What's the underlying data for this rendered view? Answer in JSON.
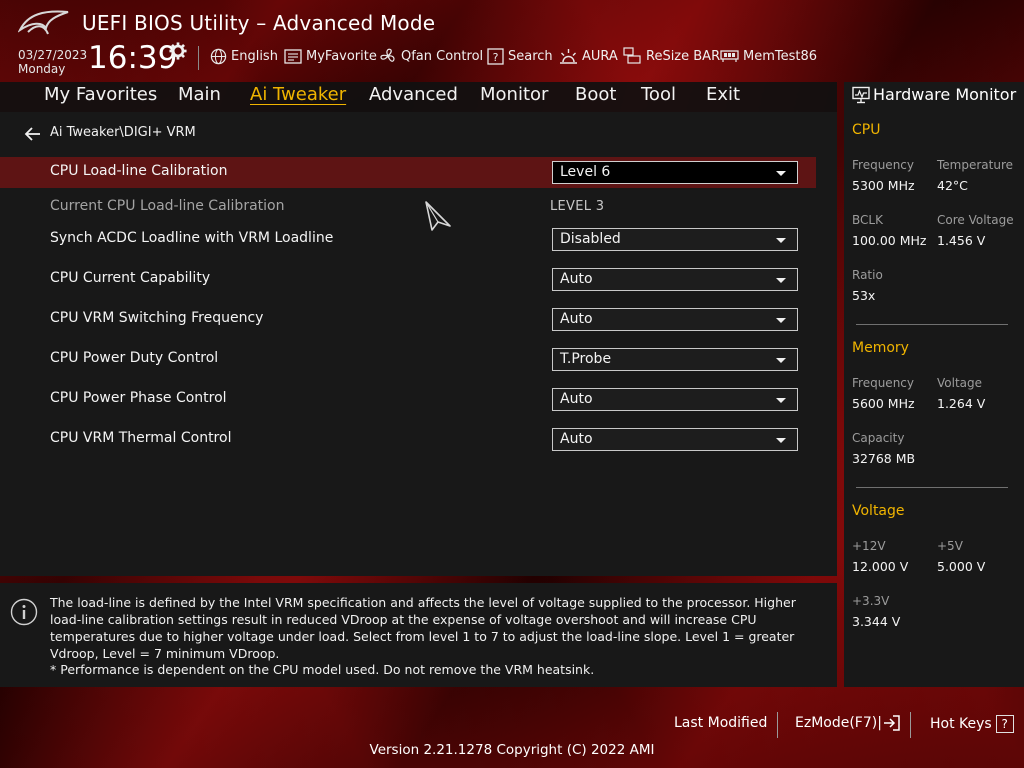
{
  "header": {
    "title": "UEFI BIOS Utility – Advanced Mode",
    "date": "03/27/2023",
    "weekday": "Monday",
    "time": "16:39",
    "tools": [
      {
        "label": "English",
        "icon": "globe-icon"
      },
      {
        "label": "MyFavorite",
        "icon": "favorite-icon"
      },
      {
        "label": "Qfan Control",
        "icon": "fan-icon"
      },
      {
        "label": "Search",
        "icon": "search-icon"
      },
      {
        "label": "AURA",
        "icon": "aura-icon"
      },
      {
        "label": "ReSize BAR",
        "icon": "resize-bar-icon"
      },
      {
        "label": "MemTest86",
        "icon": "memtest-icon"
      }
    ]
  },
  "menu": {
    "tabs": [
      "My Favorites",
      "Main",
      "Ai Tweaker",
      "Advanced",
      "Monitor",
      "Boot",
      "Tool",
      "Exit"
    ],
    "active": "Ai Tweaker"
  },
  "main": {
    "breadcrumb": "Ai Tweaker\\DIGI+ VRM",
    "items": [
      {
        "label": "CPU Load-line Calibration",
        "value": "Level 6"
      },
      {
        "label": "Current CPU Load-line Calibration",
        "value": "LEVEL 3"
      },
      {
        "label": "Synch ACDC Loadline with VRM Loadline",
        "value": "Disabled"
      },
      {
        "label": "CPU Current Capability",
        "value": "Auto"
      },
      {
        "label": "CPU VRM Switching Frequency",
        "value": "Auto"
      },
      {
        "label": "CPU Power Duty Control",
        "value": "T.Probe"
      },
      {
        "label": "CPU Power Phase Control",
        "value": "Auto"
      },
      {
        "label": "CPU VRM Thermal Control",
        "value": "Auto"
      }
    ]
  },
  "help": {
    "text": "The load-line is defined by the Intel VRM specification and affects the level of voltage supplied to the processor. Higher load-line calibration settings result in reduced VDroop at the expense of voltage overshoot and will increase CPU temperatures due to higher voltage under load. Select from level 1 to 7 to adjust the load-line slope. Level 1 = greater Vdroop, Level = 7 minimum VDroop.",
    "note": "* Performance is dependent on the CPU model used. Do not remove the VRM heatsink."
  },
  "hw": {
    "title": "Hardware Monitor",
    "cpu": {
      "heading": "CPU",
      "frequency_label": "Frequency",
      "frequency": "5300 MHz",
      "temperature_label": "Temperature",
      "temperature": "42°C",
      "bclk_label": "BCLK",
      "bclk": "100.00 MHz",
      "core_voltage_label": "Core Voltage",
      "core_voltage": "1.456 V",
      "ratio_label": "Ratio",
      "ratio": "53x"
    },
    "memory": {
      "heading": "Memory",
      "frequency_label": "Frequency",
      "frequency": "5600 MHz",
      "voltage_label": "Voltage",
      "voltage": "1.264 V",
      "capacity_label": "Capacity",
      "capacity": "32768 MB"
    },
    "voltage": {
      "heading": "Voltage",
      "v12_label": "+12V",
      "v12": "12.000 V",
      "v5_label": "+5V",
      "v5": "5.000 V",
      "v33_label": "+3.3V",
      "v33": "3.344 V"
    }
  },
  "footer": {
    "last_modified": "Last Modified",
    "ezmode": "EzMode(F7)|",
    "hotkeys": "Hot Keys",
    "hotkeys_key": "?",
    "version": "Version 2.21.1278 Copyright (C) 2022 AMI"
  },
  "colors": {
    "accent": "#f0b400",
    "highlight_row": "#5e1414",
    "panel_bg": "#181818"
  }
}
